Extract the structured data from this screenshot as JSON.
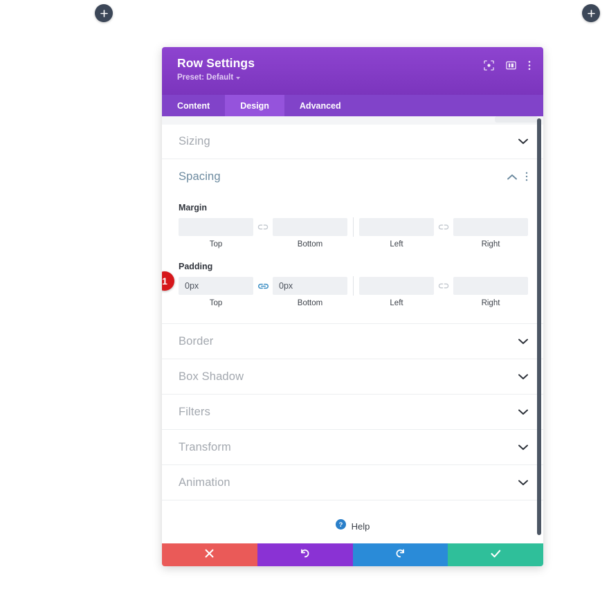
{
  "canvas": {
    "add_button_left": {
      "label": "+",
      "icon": "plus-icon"
    },
    "add_button_right": {
      "label": "+",
      "icon": "plus-icon"
    }
  },
  "modal": {
    "title": "Row Settings",
    "preset_label": "Preset: Default",
    "header_icons": [
      {
        "name": "focus-target-icon"
      },
      {
        "name": "layout-columns-icon"
      },
      {
        "name": "more-vertical-icon"
      }
    ],
    "tabs": [
      {
        "label": "Content",
        "active": false
      },
      {
        "label": "Design",
        "active": true
      },
      {
        "label": "Advanced",
        "active": false
      }
    ],
    "search": {
      "placeholder": ""
    },
    "sections": [
      {
        "label": "Sizing",
        "open": false
      },
      {
        "label": "Border",
        "open": false
      },
      {
        "label": "Box Shadow",
        "open": false
      },
      {
        "label": "Filters",
        "open": false
      },
      {
        "label": "Transform",
        "open": false
      },
      {
        "label": "Animation",
        "open": false
      }
    ],
    "spacing": {
      "label": "Spacing",
      "open": true,
      "margin": {
        "label": "Margin",
        "top": {
          "value": "",
          "placeholder": "",
          "caption": "Top"
        },
        "bottom": {
          "value": "",
          "placeholder": "",
          "caption": "Bottom"
        },
        "left": {
          "value": "",
          "placeholder": "",
          "caption": "Left"
        },
        "right": {
          "value": "",
          "placeholder": "",
          "caption": "Right"
        },
        "link_top_bottom": "unlinked",
        "link_left_right": "unlinked"
      },
      "padding": {
        "label": "Padding",
        "top": {
          "value": "0px",
          "placeholder": "",
          "caption": "Top"
        },
        "bottom": {
          "value": "0px",
          "placeholder": "",
          "caption": "Bottom"
        },
        "left": {
          "value": "",
          "placeholder": "",
          "caption": "Left"
        },
        "right": {
          "value": "",
          "placeholder": "",
          "caption": "Right"
        },
        "link_top_bottom": "linked",
        "link_left_right": "unlinked"
      },
      "step_badge": "1"
    },
    "help": {
      "label": "Help",
      "icon": "help-circle-icon"
    },
    "footer": [
      {
        "name": "cancel-button",
        "icon": "close-icon",
        "color": "#ea5a58"
      },
      {
        "name": "undo-button",
        "icon": "undo-icon",
        "color": "#8a32d4"
      },
      {
        "name": "redo-button",
        "icon": "redo-icon",
        "color": "#2a8bd8"
      },
      {
        "name": "save-button",
        "icon": "check-icon",
        "color": "#2fbf9a"
      }
    ]
  },
  "colors": {
    "header_purple": "#7d3ec1",
    "tab_active": "#9553dc",
    "badge_red": "#d6171b",
    "link_active_blue": "#3d8fc4",
    "section_open_blue": "#6c8a9f"
  }
}
